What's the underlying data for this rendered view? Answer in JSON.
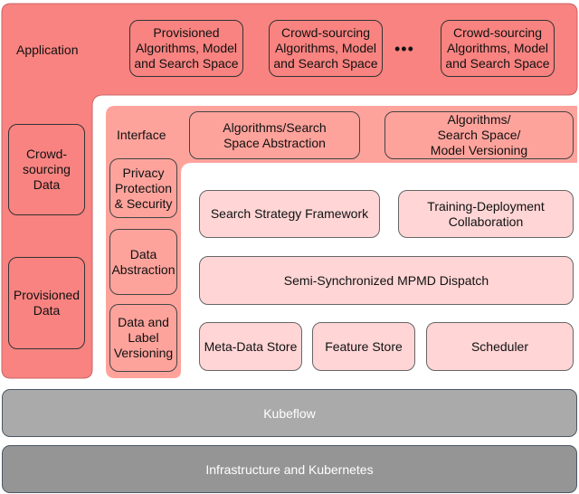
{
  "application": {
    "label": "Application",
    "boxes": [
      "Provisioned Algorithms, Model and Search Space",
      "Crowd-sourcing Algorithms, Model and Search Space",
      "Crowd-sourcing Algorithms, Model and Search Space"
    ],
    "ellipsis": "•••",
    "data_boxes": [
      "Crowd-sourcing Data",
      "Provisioned Data"
    ]
  },
  "interface": {
    "label": "Interface",
    "top_boxes": [
      "Algorithms/Search Space Abstraction",
      "Algorithms/ Search Space/ Model Versioning"
    ],
    "side_boxes": [
      "Privacy Protection & Security",
      "Data Abstraction",
      "Data and Label Versioning"
    ]
  },
  "core": {
    "search_strategy": "Search Strategy Framework",
    "training_deployment": "Training-Deployment Collaboration",
    "dispatch": "Semi-Synchronized MPMD Dispatch",
    "metadata_store": "Meta-Data Store",
    "feature_store": "Feature Store",
    "scheduler": "Scheduler"
  },
  "layers": {
    "kubeflow": "Kubeflow",
    "infrastructure": "Infrastructure and Kubernetes"
  },
  "colors": {
    "application": "#f88380",
    "interface": "#fea39c",
    "core": "#ffd5d5",
    "kubeflow": "#aaaaaa",
    "infrastructure": "#959595"
  }
}
